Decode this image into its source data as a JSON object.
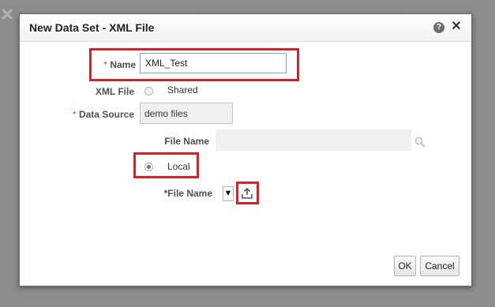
{
  "background": {
    "close_glyph": "✕"
  },
  "dialog": {
    "title": "New Data Set - XML File",
    "help_glyph": "?",
    "close_glyph": "✕"
  },
  "form": {
    "name": {
      "required_mark": "*",
      "label": "Name",
      "value": "XML_Test"
    },
    "xml_file": {
      "label": "XML File",
      "option_shared": "Shared"
    },
    "data_source": {
      "required_mark": "*",
      "label": "Data Source",
      "value": "demo files"
    },
    "file_name_shared": {
      "label": "File Name",
      "value": ""
    },
    "local": {
      "option_local": "Local",
      "selected": true
    },
    "file_name_local": {
      "label": "*File Name",
      "dropdown_glyph": "▼"
    }
  },
  "buttons": {
    "ok": "OK",
    "cancel": "Cancel"
  },
  "icons": [
    "close-icon",
    "help-icon",
    "search-icon",
    "upload-icon",
    "dropdown-arrow-icon"
  ],
  "colors": {
    "highlight": "#d2232a",
    "required": "#4b6cb5",
    "focus_border": "#7ea6d6"
  }
}
